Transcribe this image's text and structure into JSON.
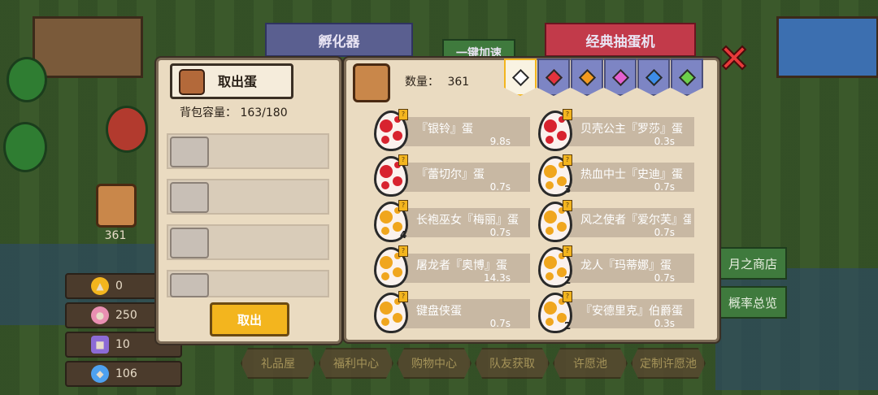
{
  "top_tabs": {
    "incubator": "孵化器",
    "one_click_speedup": "一键加速",
    "classic_gacha": "经典抽蛋机"
  },
  "sidebar": {
    "basket_count": "361"
  },
  "currencies": [
    {
      "icon": "ticket-icon",
      "value": "0",
      "color": "#f3b51e"
    },
    {
      "icon": "candy-icon",
      "value": "250",
      "color": "#e98fb2"
    },
    {
      "icon": "character-card-icon",
      "value": "10",
      "color": "#8c6bd6"
    },
    {
      "icon": "diamond-icon",
      "value": "106",
      "color": "#4ea1f0"
    }
  ],
  "bottom_nav": [
    "礼品屋",
    "福利中心",
    "购物中心",
    "队友获取",
    "许愿池",
    "定制许愿池"
  ],
  "right_menu": {
    "moon_shop": "月之商店",
    "probability": "概率总览"
  },
  "pickup_panel": {
    "title": "取出蛋",
    "capacity_label": "背包容量：",
    "capacity_value": "163/180",
    "take_out_button": "取出"
  },
  "egg_panel": {
    "count_label": "数量：",
    "count_value": "361",
    "filters": [
      {
        "name": "all",
        "color": "#2a2a2a",
        "selected": true
      },
      {
        "name": "red",
        "color": "#e5323d",
        "selected": false
      },
      {
        "name": "orange",
        "color": "#f39a1e",
        "selected": false
      },
      {
        "name": "pink",
        "color": "#e45fd0",
        "selected": false
      },
      {
        "name": "blue",
        "color": "#3d8de8",
        "selected": false
      },
      {
        "name": "green",
        "color": "#6ccf4a",
        "selected": false
      }
    ],
    "eggs": [
      {
        "name": "『银铃』蛋",
        "time": "9.8s",
        "type": "red",
        "count": ""
      },
      {
        "name": "贝壳公主『罗莎』蛋",
        "time": "0.3s",
        "type": "red",
        "count": ""
      },
      {
        "name": "『蕾切尔』蛋",
        "time": "0.7s",
        "type": "red",
        "count": ""
      },
      {
        "name": "热血中士『史迪』蛋",
        "time": "0.7s",
        "type": "gold",
        "count": "3"
      },
      {
        "name": "长袍巫女『梅丽』蛋",
        "time": "0.7s",
        "type": "gold",
        "count": "4"
      },
      {
        "name": "风之使者『爱尔芙』蛋",
        "time": "0.7s",
        "type": "gold",
        "count": ""
      },
      {
        "name": "屠龙者『奥博』蛋",
        "time": "14.3s",
        "type": "gold",
        "count": ""
      },
      {
        "name": "龙人『玛蒂娜』蛋",
        "time": "0.7s",
        "type": "gold",
        "count": "2"
      },
      {
        "name": "键盘侠蛋",
        "time": "0.7s",
        "type": "gold",
        "count": ""
      },
      {
        "name": "『安德里克』伯爵蛋",
        "time": "0.3s",
        "type": "gold",
        "count": "2"
      }
    ]
  }
}
